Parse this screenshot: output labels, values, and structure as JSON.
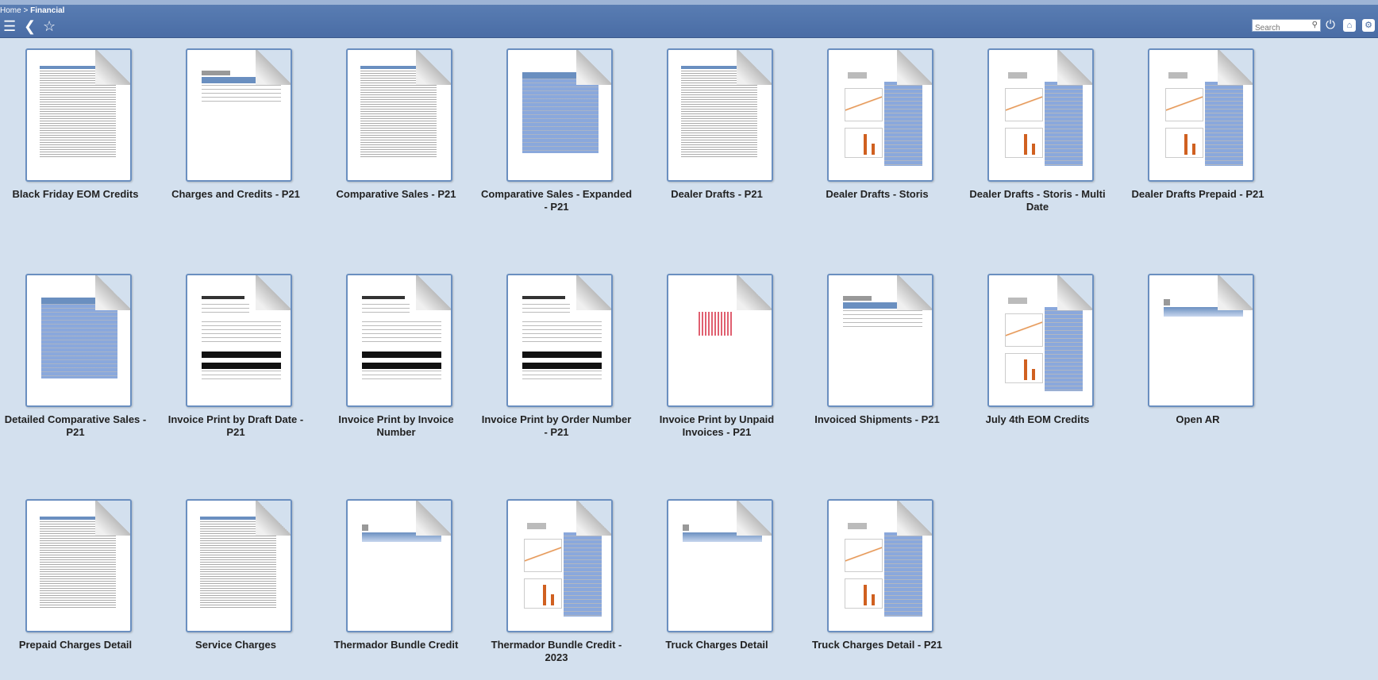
{
  "breadcrumb": {
    "home": "Home",
    "separator": " > ",
    "current": "Financial"
  },
  "toolbar": {
    "menu_icon": "hamburger-menu-icon",
    "back_icon": "back-arrow-icon",
    "favorite_icon": "star-icon",
    "search_placeholder": "Search",
    "power_icon": "power-icon",
    "home_icon": "home-icon",
    "settings_icon": "settings-icon"
  },
  "colors": {
    "header": "#4a6da5",
    "background": "#d3e0ee",
    "accent": "#6a8fc0"
  },
  "reports": [
    {
      "label": "Black Friday EOM Credits",
      "thumb": "table"
    },
    {
      "label": "Charges and Credits - P21",
      "thumb": "bandtable"
    },
    {
      "label": "Comparative Sales - P21",
      "thumb": "table"
    },
    {
      "label": "Comparative Sales - Expanded - P21",
      "thumb": "bluetable"
    },
    {
      "label": "Dealer Drafts - P21",
      "thumb": "table"
    },
    {
      "label": "Dealer Drafts - Storis",
      "thumb": "dashboard"
    },
    {
      "label": "Dealer Drafts - Storis - Multi Date",
      "thumb": "dashboard"
    },
    {
      "label": "Dealer Drafts Prepaid - P21",
      "thumb": "dashboard"
    },
    {
      "label": "Detailed Comparative Sales - P21",
      "thumb": "bluetable"
    },
    {
      "label": "Invoice Print by Draft Date - P21",
      "thumb": "invoice"
    },
    {
      "label": "Invoice Print by Invoice Number",
      "thumb": "invoice"
    },
    {
      "label": "Invoice Print by Order Number - P21",
      "thumb": "invoice"
    },
    {
      "label": "Invoice Print by Unpaid Invoices - P21",
      "thumb": "red"
    },
    {
      "label": "Invoiced Shipments - P21",
      "thumb": "bandtable"
    },
    {
      "label": "July 4th EOM Credits",
      "thumb": "dashboard"
    },
    {
      "label": "Open AR",
      "thumb": "band"
    },
    {
      "label": "Prepaid Charges Detail",
      "thumb": "table"
    },
    {
      "label": "Service Charges",
      "thumb": "table"
    },
    {
      "label": "Thermador Bundle Credit",
      "thumb": "band"
    },
    {
      "label": "Thermador Bundle Credit - 2023",
      "thumb": "dashboard"
    },
    {
      "label": "Truck Charges Detail",
      "thumb": "band"
    },
    {
      "label": "Truck Charges Detail - P21",
      "thumb": "dashboard"
    }
  ]
}
